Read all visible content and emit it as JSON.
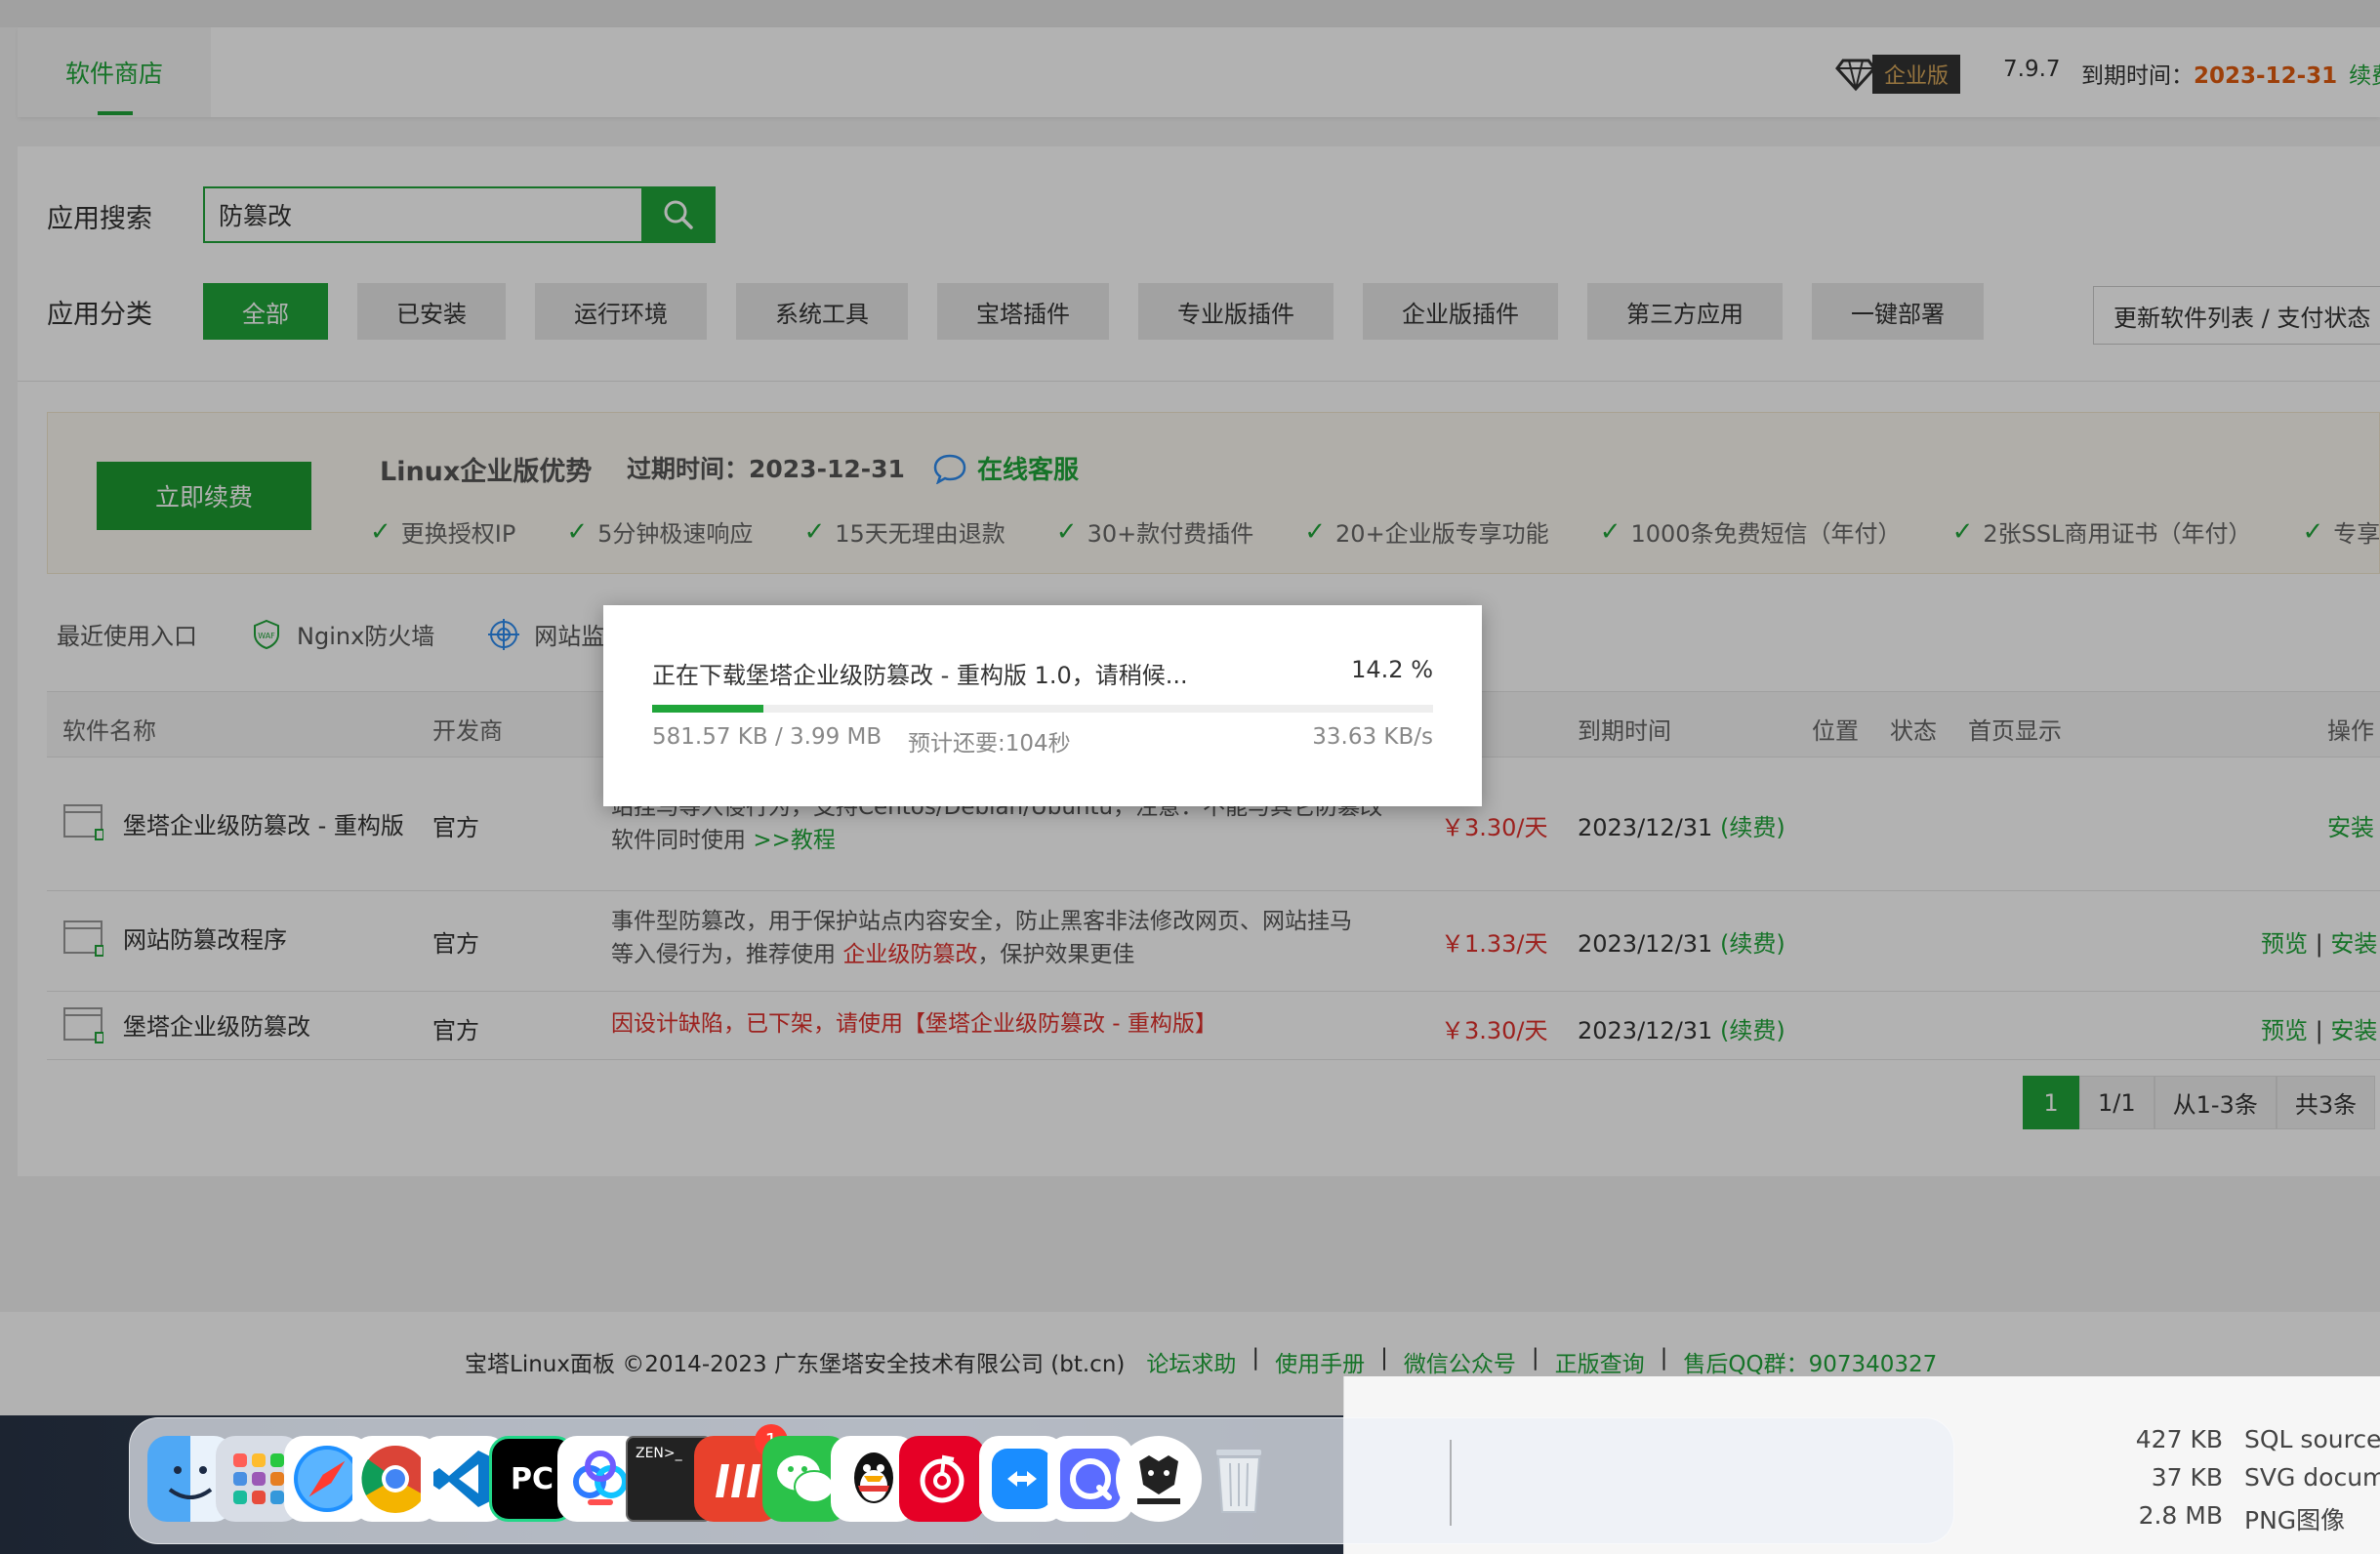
{
  "header": {
    "store_tab": "软件商店",
    "edition": "企业版",
    "version": "7.9.7",
    "expiry_label": "到期时间：",
    "expiry_date": "2023-12-31",
    "renew": "续费"
  },
  "search": {
    "label": "应用搜索",
    "value": "防篡改"
  },
  "categories": {
    "label": "应用分类",
    "items": [
      "全部",
      "已安装",
      "运行环境",
      "系统工具",
      "宝塔插件",
      "专业版插件",
      "企业版插件",
      "第三方应用",
      "一键部署"
    ],
    "refresh": "更新软件列表 / 支付状态"
  },
  "promo": {
    "renew_button": "立即续费",
    "title": "Linux企业版优势",
    "expiry": "过期时间：2023-12-31",
    "service": "在线客服",
    "features": [
      "更换授权IP",
      "5分钟极速响应",
      "15天无理由退款",
      "30+款付费插件",
      "20+企业版专享功能",
      "1000条免费短信（年付）",
      "2张SSL商用证书（年付）",
      "专享"
    ]
  },
  "recent": {
    "label": "最近使用入口",
    "items": [
      "Nginx防火墙",
      "网站监"
    ]
  },
  "table": {
    "headers": {
      "name": "软件名称",
      "developer": "开发商",
      "expire": "到期时间",
      "position": "位置",
      "status": "状态",
      "homepage": "首页显示",
      "action": "操作"
    },
    "rows": [
      {
        "name": "堡塔企业级防篡改 - 重构版",
        "developer": "官方",
        "desc1": "站挂马等入侵行为，支持Centos/Debian/Ubuntu，注意：不能与其它防篡改",
        "desc2": "软件同时使用 ",
        "tutorial": ">>教程",
        "price": "￥3.30/天",
        "expire": "2023/12/31",
        "renew": "(续费)",
        "install": "安装"
      },
      {
        "name": "网站防篡改程序",
        "developer": "官方",
        "desc1": "事件型防篡改，用于保护站点内容安全，防止黑客非法修改网页、网站挂马",
        "desc2": "等入侵行为，推荐使用 ",
        "desc_link": "企业级防篡改",
        "desc3": "，保护效果更佳",
        "price": "￥1.33/天",
        "expire": "2023/12/31",
        "renew": "(续费)",
        "preview": "预览",
        "install": "安装"
      },
      {
        "name": "堡塔企业级防篡改",
        "developer": "官方",
        "desc_red": "因设计缺陷，已下架，请使用【堡塔企业级防篡改 - 重构版】",
        "price": "￥3.30/天",
        "expire": "2023/12/31",
        "renew": "(续费)",
        "preview": "预览",
        "install": "安装"
      }
    ]
  },
  "pager": {
    "current": "1",
    "pages": "1/1",
    "range": "从1-3条",
    "total": "共3条"
  },
  "footer": {
    "copyright": "宝塔Linux面板 ©2014-2023 广东堡塔安全技术有限公司 (bt.cn)",
    "links": [
      "论坛求助",
      "使用手册",
      "微信公众号",
      "正版查询"
    ],
    "qq": "售后QQ群：907340327"
  },
  "dialog": {
    "title": "正在下载堡塔企业级防篡改 - 重构版 1.0，请稍候...",
    "percent": "14.2 %",
    "progress": 0.142,
    "size": "581.57 KB / 3.99 MB",
    "eta": "预计还要:104秒",
    "speed": "33.63 KB/s"
  },
  "finder": {
    "rows": [
      {
        "size": "427 KB",
        "kind": "SQL source file"
      },
      {
        "size": "37 KB",
        "kind": "SVG document"
      },
      {
        "size": "2.8 MB",
        "kind": "PNG图像"
      }
    ]
  },
  "dock": {
    "apps": [
      "finder-icon",
      "launchpad-icon",
      "safari-icon",
      "chrome-icon",
      "vscode-icon",
      "pycharm-icon",
      "baidu-netdisk-icon",
      "zenterm-icon",
      "weibo-icon",
      "wechat-icon",
      "qq-icon",
      "netease-music-icon",
      "teamviewer-icon",
      "quark-icon",
      "tiger-app-icon",
      "trash-icon"
    ],
    "weibo_badge": "1",
    "pycharm_label": "PC",
    "zen_label": "ZEN>_"
  }
}
